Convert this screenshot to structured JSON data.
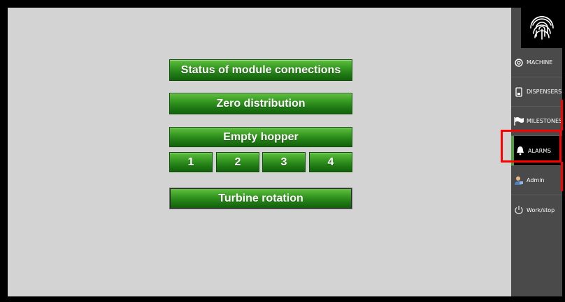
{
  "main": {
    "buttons": {
      "status": "Status of module connections",
      "zero": "Zero distribution",
      "empty_hopper": "Empty hopper",
      "hopper_1": "1",
      "hopper_2": "2",
      "hopper_3": "3",
      "hopper_4": "4",
      "turbine": "Turbine rotation"
    }
  },
  "sidebar": {
    "logo_icon": "fingerprint-icon",
    "items": [
      {
        "label": "MACHINE",
        "icon": "gear-icon"
      },
      {
        "label": "DISPENSERS",
        "icon": "phone-icon"
      },
      {
        "label": "MILESTONES",
        "icon": "flag-icon"
      },
      {
        "label": "ALARMS",
        "icon": "bell-icon",
        "active": true
      },
      {
        "label": "Admin",
        "icon": "user-icon"
      },
      {
        "label": "Work/stop",
        "icon": "power-icon"
      }
    ]
  },
  "colors": {
    "button_green": "#3a9d24",
    "active_accent": "#4aa33a",
    "highlight": "#ff0000",
    "sidebar_bg": "#4a4a4a",
    "main_bg": "#d3d3d3"
  }
}
